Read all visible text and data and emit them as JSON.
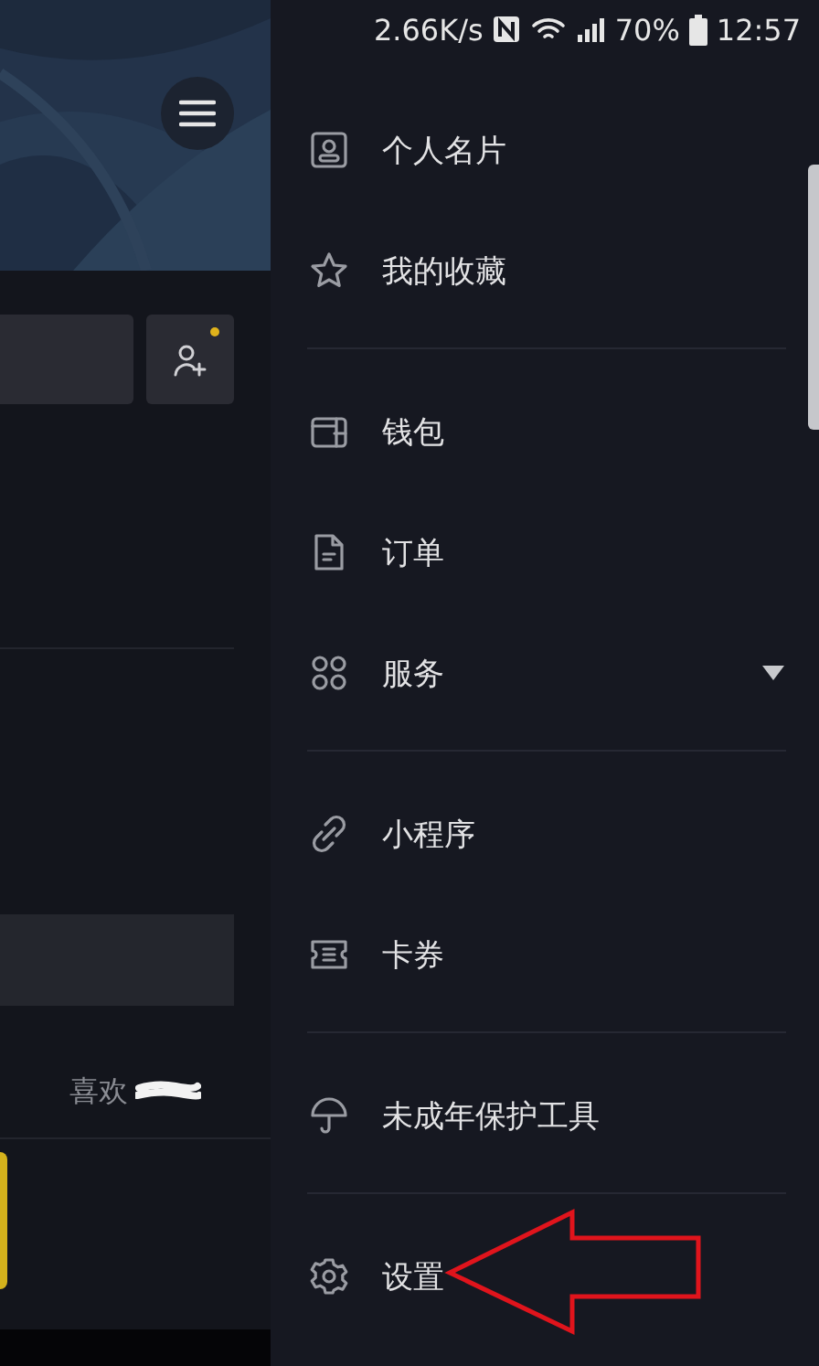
{
  "status_bar": {
    "speed": "2.66K/s",
    "battery": "70%",
    "time": "12:57"
  },
  "profile": {
    "add_friend": {
      "unread": true
    },
    "likes_label": "喜欢"
  },
  "drawer": {
    "sections": [
      {
        "items": [
          {
            "kind": "card",
            "label": "个人名片",
            "has_submenu": false
          },
          {
            "kind": "star",
            "label": "我的收藏",
            "has_submenu": false
          }
        ]
      },
      {
        "items": [
          {
            "kind": "wallet",
            "label": "钱包",
            "has_submenu": false
          },
          {
            "kind": "document",
            "label": "订单",
            "has_submenu": false
          },
          {
            "kind": "grid",
            "label": "服务",
            "has_submenu": true
          }
        ]
      },
      {
        "items": [
          {
            "kind": "link",
            "label": "小程序",
            "has_submenu": false
          },
          {
            "kind": "ticket",
            "label": "卡券",
            "has_submenu": false
          }
        ]
      },
      {
        "items": [
          {
            "kind": "umbrella",
            "label": "未成年保护工具",
            "has_submenu": false
          }
        ]
      },
      {
        "items": [
          {
            "kind": "gear",
            "label": "设置",
            "has_submenu": false
          }
        ]
      }
    ]
  }
}
